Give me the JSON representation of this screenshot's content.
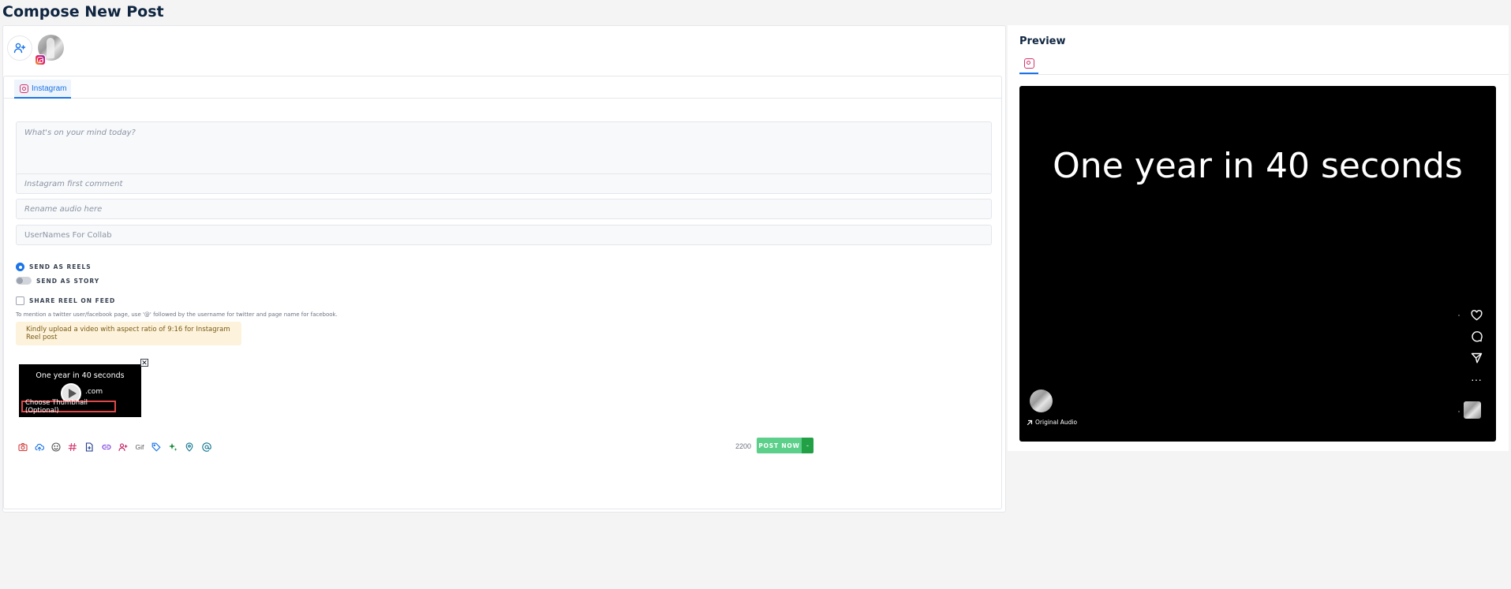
{
  "page": {
    "title": "Compose New Post"
  },
  "accounts": {
    "add_icon": "add-user-icon",
    "avatar_icon": "instagram-icon"
  },
  "tabs": [
    {
      "label": "Instagram",
      "icon": "instagram-icon"
    }
  ],
  "fields": {
    "message_placeholder": "What's on your mind today?",
    "first_comment_placeholder": "Instagram first comment",
    "rename_audio_placeholder": "Rename audio here",
    "collab_placeholder": "UserNames For Collab"
  },
  "options": {
    "send_as_reels": "SEND AS REELS",
    "send_as_story": "SEND AS STORY",
    "share_reel_on_feed": "SHARE REEL ON FEED"
  },
  "hint": "To mention a twitter user/facebook page, use '@' followed by the username for twitter and page name for facebook.",
  "warning": "Kindly upload a video with aspect ratio of 9:16 for Instagram Reel post",
  "media": {
    "thumb_title": "One year in 40 seconds",
    "thumb_sub": ".com",
    "choose_thumbnail": "Choose Thumbnail (Optional)",
    "close_symbol": "✕"
  },
  "toolbar": {
    "icons": [
      "camera-icon",
      "upload-icon",
      "emoji-icon",
      "hashtag-icon",
      "document-icon",
      "link-icon",
      "tag-user-icon",
      "gif-icon",
      "tag-icon",
      "sparkle-icon",
      "location-icon",
      "mention-icon"
    ],
    "gif_label": "Gif",
    "char_count": "2200",
    "post_now": "POST NOW",
    "post_menu_symbol": "-"
  },
  "colors": {
    "accent": "#1a73e8",
    "post_now": "#5ccf8a",
    "post_menu": "#22a046",
    "warning_bg": "#fdf3dc"
  },
  "preview": {
    "title": "Preview",
    "tab_icon": "instagram-icon",
    "reel_title": "One year in 40 seconds",
    "audio_label": "Original Audio",
    "more_symbol": "···"
  }
}
